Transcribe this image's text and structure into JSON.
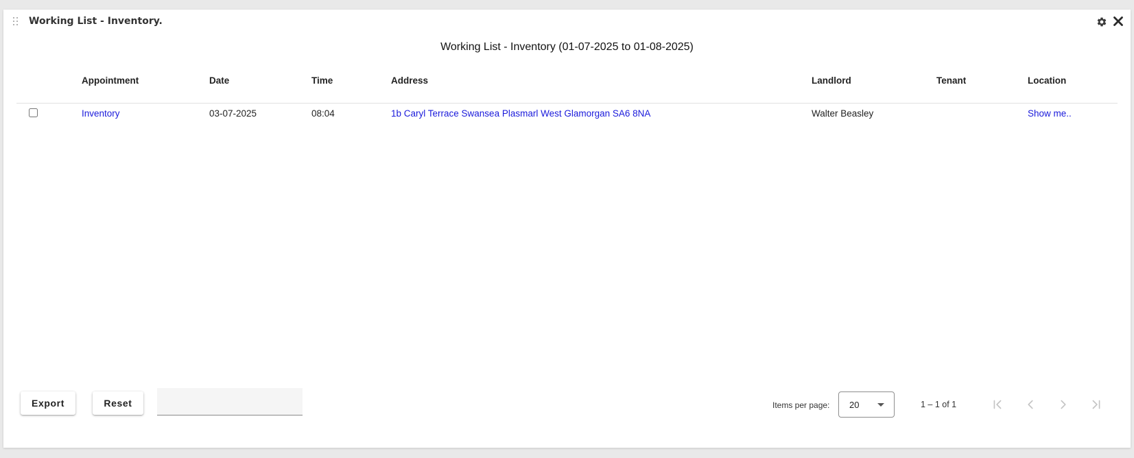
{
  "panel": {
    "title": "Working List - Inventory."
  },
  "report": {
    "title": "Working List - Inventory (01-07-2025 to 01-08-2025)"
  },
  "table": {
    "columns": {
      "appointment": "Appointment",
      "date": "Date",
      "time": "Time",
      "address": "Address",
      "landlord": "Landlord",
      "tenant": "Tenant",
      "location": "Location"
    },
    "rows": [
      {
        "appointment": "Inventory",
        "date": "03-07-2025",
        "time": "08:04",
        "address": "1b Caryl Terrace Swansea Plasmarl West Glamorgan SA6 8NA",
        "landlord": "Walter Beasley",
        "tenant": "",
        "location": "Show me.."
      }
    ]
  },
  "footer": {
    "export_label": "Export",
    "reset_label": "Reset",
    "filter_value": "",
    "items_per_page_label": "Items per page:",
    "items_per_page_value": "20",
    "range_label": "1 – 1 of 1"
  },
  "icons": {
    "drag": "drag-handle-icon",
    "settings": "gear-icon",
    "close": "close-icon",
    "first": "first-page-icon",
    "prev": "chevron-left-icon",
    "next": "chevron-right-icon",
    "last": "last-page-icon"
  },
  "colors": {
    "link": "#1a1adb",
    "background": "#e9e9e9",
    "panel": "#ffffff"
  }
}
